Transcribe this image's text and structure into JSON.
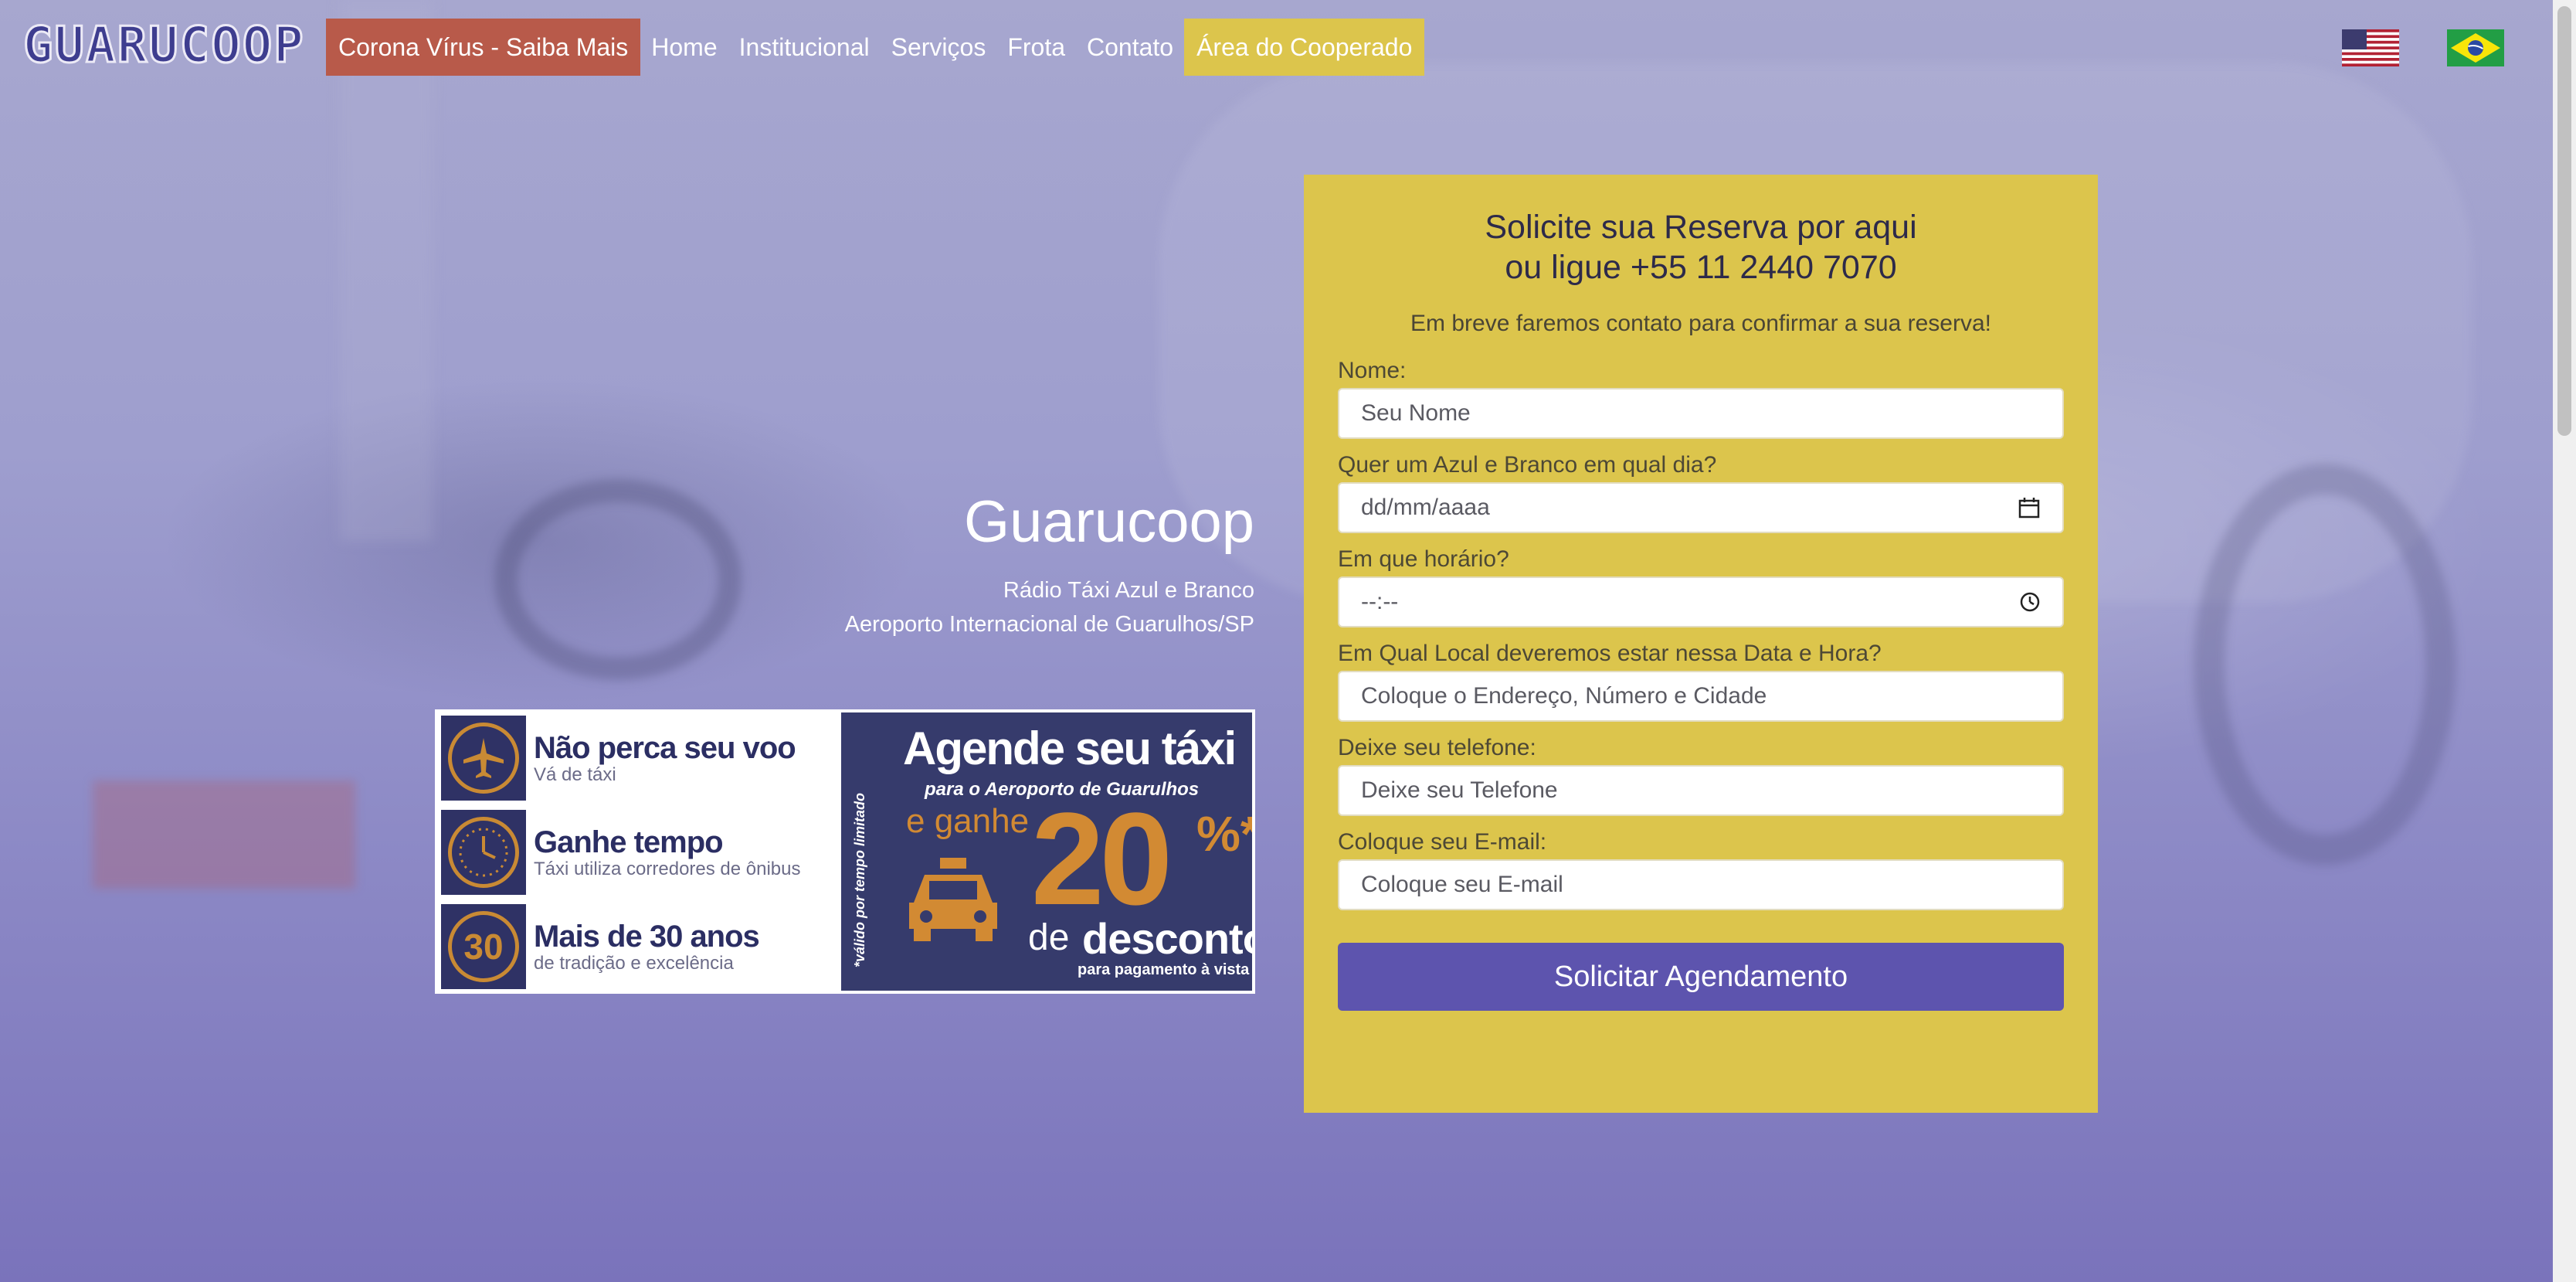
{
  "brand": {
    "logo_text": "GUARUCOOP"
  },
  "nav": {
    "items": [
      {
        "label": "Corona Vírus - Saiba Mais"
      },
      {
        "label": "Home"
      },
      {
        "label": "Institucional"
      },
      {
        "label": "Serviços"
      },
      {
        "label": "Frota"
      },
      {
        "label": "Contato"
      },
      {
        "label": "Área do Cooperado"
      }
    ],
    "highlight_colors": {
      "corona": "#b85a4a",
      "cooperado": "#dcc54c"
    },
    "flags": [
      "flag-us-icon",
      "flag-br-icon"
    ]
  },
  "hero": {
    "title": "Guarucoop",
    "line1": "Rádio Táxi Azul e Branco",
    "line2": "Aeroporto Internacional de Guarulhos/SP"
  },
  "banner": {
    "rows": [
      {
        "icon": "airplane-icon",
        "head": "Não perca seu voo",
        "sub": "Vá de táxi"
      },
      {
        "icon": "clock-icon",
        "head": "Ganhe tempo",
        "sub": "Táxi utiliza corredores de ônibus"
      },
      {
        "icon": "badge-30-icon",
        "icon_text": "30",
        "head": "Mais de 30 anos",
        "sub": "de tradição e excelência"
      }
    ],
    "headline": "Agende seu táxi",
    "subhead": "para o Aeroporto de Guarulhos",
    "e_ganhe": "e ganhe",
    "percent": "20",
    "percent_sign": "%*",
    "de": "de",
    "desconto": "desconto",
    "pagamento": "para pagamento à vista",
    "disclaimer": "*válido por tempo limitado",
    "colors": {
      "navy": "#363b6c",
      "orange": "#d28a33"
    }
  },
  "form": {
    "title_line1": "Solicite sua Reserva por aqui",
    "title_line2": "ou ligue +55 11 2440 7070",
    "description": "Em breve faremos contato para confirmar a sua reserva!",
    "fields": [
      {
        "label": "Nome:",
        "placeholder": "Seu Nome"
      },
      {
        "label": "Quer um Azul e Branco em qual dia?",
        "placeholder": "dd/mm/aaaa",
        "icon": "calendar-icon"
      },
      {
        "label": "Em que horário?",
        "placeholder": "--:--",
        "icon": "clock-icon"
      },
      {
        "label": "Em Qual Local deveremos estar nessa Data e Hora?",
        "placeholder": "Coloque o Endereço, Número e Cidade"
      },
      {
        "label": "Deixe seu telefone:",
        "placeholder": "Deixe seu Telefone"
      },
      {
        "label": "Coloque seu E-mail:",
        "placeholder": "Coloque seu E-mail"
      }
    ],
    "submit_label": "Solicitar Agendamento",
    "colors": {
      "card": "#dcc54c",
      "button": "#5d54ae"
    }
  }
}
